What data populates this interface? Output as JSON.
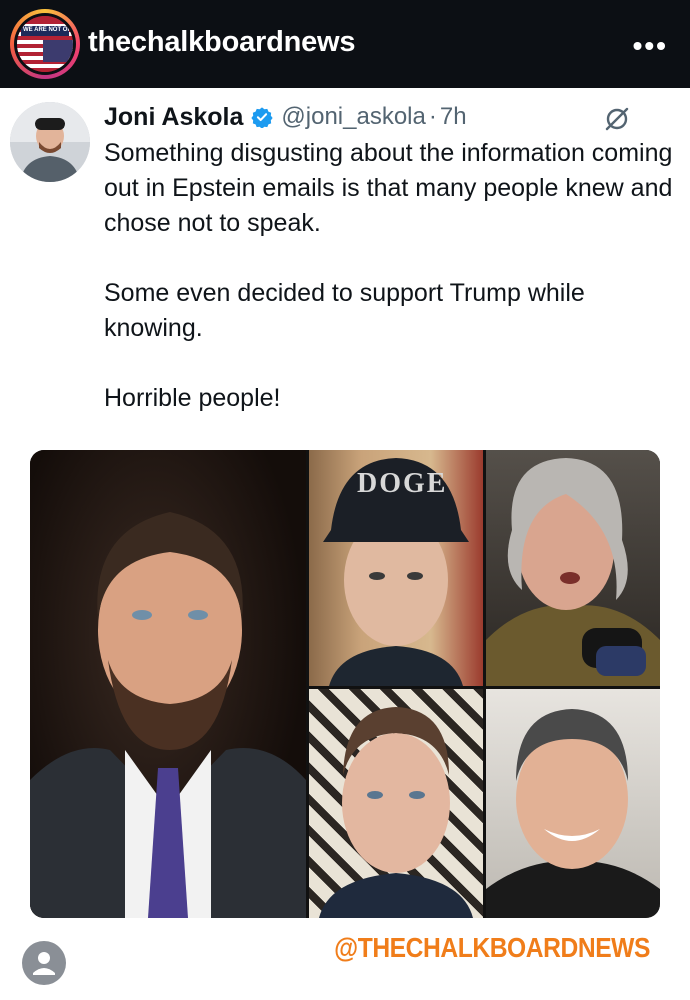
{
  "header": {
    "username": "thechalkboardnews",
    "more_label": "•••",
    "avatar_badge": "WE ARE NOT OK"
  },
  "tweet": {
    "name": "Joni Askola",
    "handle": "@joni_askola",
    "separator": "·",
    "time": "7h",
    "verified_color": "#1d9bf0",
    "lines": [
      "Something disgusting about the information coming out in Epstein emails is that many people knew and chose not to speak.",
      "Some even decided to support Trump while knowing.",
      "Horrible people!"
    ]
  },
  "collage": {
    "cap_text": "DOGE"
  },
  "footer": {
    "watermark": "@THECHALKBOARDNEWS",
    "watermark_color": "#f07d1a"
  }
}
